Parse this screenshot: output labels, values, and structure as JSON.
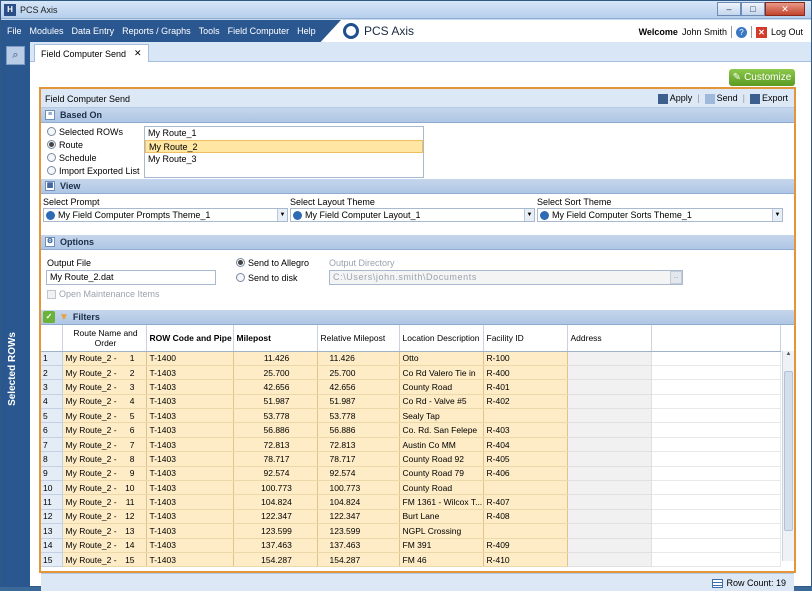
{
  "window": {
    "title": "PCS Axis",
    "app_logo_text": "PCS Axis"
  },
  "menu": [
    "File",
    "Modules",
    "Data Entry",
    "Reports / Graphs",
    "Tools",
    "Field Computer",
    "Help"
  ],
  "user": {
    "welcome": "Welcome",
    "name": "John Smith",
    "logout": "Log Out"
  },
  "sidebar": {
    "label": "Selected ROWs"
  },
  "tab": {
    "label": "Field Computer Send",
    "close": "✕"
  },
  "customize": "Customize",
  "panel": {
    "title": "Field Computer Send",
    "actions": {
      "apply": "Apply",
      "send": "Send",
      "export": "Export"
    }
  },
  "based_on": {
    "header": "Based On",
    "options": [
      {
        "label": "Selected ROWs",
        "checked": false
      },
      {
        "label": "Route",
        "checked": true
      },
      {
        "label": "Schedule",
        "checked": false
      },
      {
        "label": "Import Exported List",
        "checked": false
      }
    ],
    "routes": [
      "My Route_1",
      "My Route_2",
      "My Route_3"
    ],
    "selected_route": "My Route_2"
  },
  "view": {
    "header": "View",
    "prompt_label": "Select Prompt",
    "prompt_value": "My Field Computer Prompts Theme_1",
    "layout_label": "Select Layout Theme",
    "layout_value": "My Field Computer Layout_1",
    "sort_label": "Select Sort Theme",
    "sort_value": "My Field Computer Sorts Theme_1"
  },
  "options": {
    "header": "Options",
    "output_file_label": "Output File",
    "output_file_value": "My Route_2.dat",
    "open_maintenance": "Open Maintenance Items",
    "send_allegro": "Send to Allegro",
    "send_disk": "Send to disk",
    "output_dir_label": "Output Directory",
    "output_dir_value": "C:\\Users\\john.smith\\Documents"
  },
  "filters": {
    "header": "Filters"
  },
  "grid": {
    "columns": [
      "Route Name and Order",
      "ROW Code and Pipe",
      "Milepost",
      "Relative Milepost",
      "Location Description",
      "Facility ID",
      "Address"
    ],
    "rows": [
      [
        "1",
        "My Route_2 -",
        "1",
        "T-1400",
        "11.426",
        "11.426",
        "Otto",
        "R-100"
      ],
      [
        "2",
        "My Route_2 -",
        "2",
        "T-1403",
        "25.700",
        "25.700",
        "Co Rd Valero Tie in",
        "R-400"
      ],
      [
        "3",
        "My Route_2 -",
        "3",
        "T-1403",
        "42.656",
        "42.656",
        "County Road",
        "R-401"
      ],
      [
        "4",
        "My Route_2 -",
        "4",
        "T-1403",
        "51.987",
        "51.987",
        "Co Rd - Valve #5",
        "R-402"
      ],
      [
        "5",
        "My Route_2 -",
        "5",
        "T-1403",
        "53.778",
        "53.778",
        "Sealy Tap",
        ""
      ],
      [
        "6",
        "My Route_2 -",
        "6",
        "T-1403",
        "56.886",
        "56.886",
        "Co. Rd. San Felepe",
        "R-403"
      ],
      [
        "7",
        "My Route_2 -",
        "7",
        "T-1403",
        "72.813",
        "72.813",
        "Austin Co MM",
        "R-404"
      ],
      [
        "8",
        "My Route_2 -",
        "8",
        "T-1403",
        "78.717",
        "78.717",
        "County Road 92",
        "R-405"
      ],
      [
        "9",
        "My Route_2 -",
        "9",
        "T-1403",
        "92.574",
        "92.574",
        "County Road 79",
        "R-406"
      ],
      [
        "10",
        "My Route_2 -",
        "10",
        "T-1403",
        "100.773",
        "100.773",
        "County Road",
        ""
      ],
      [
        "11",
        "My Route_2 -",
        "11",
        "T-1403",
        "104.824",
        "104.824",
        "FM 1361 - Wilcox T...",
        "R-407"
      ],
      [
        "12",
        "My Route_2 -",
        "12",
        "T-1403",
        "122.347",
        "122.347",
        "Burt Lane",
        "R-408"
      ],
      [
        "13",
        "My Route_2 -",
        "13",
        "T-1403",
        "123.599",
        "123.599",
        "NGPL Crossing",
        ""
      ],
      [
        "14",
        "My Route_2 -",
        "14",
        "T-1403",
        "137.463",
        "137.463",
        "FM 391",
        "R-409"
      ],
      [
        "15",
        "My Route_2 -",
        "15",
        "T-1403",
        "154.287",
        "154.287",
        "FM 46",
        "R-410"
      ]
    ],
    "row_count": "Row Count: 19"
  }
}
